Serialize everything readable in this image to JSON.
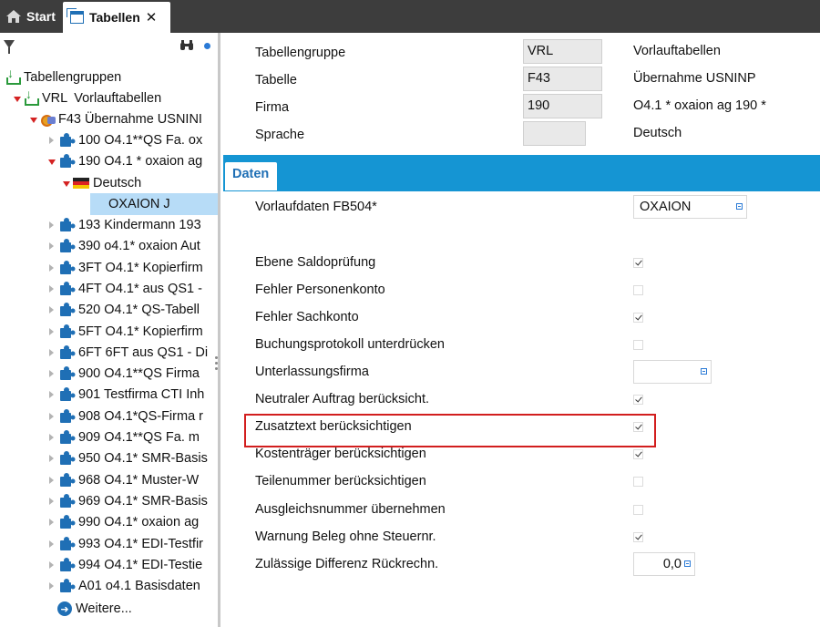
{
  "tabs": [
    {
      "label": "Start",
      "icon": "home-icon"
    },
    {
      "label": "Tabellen",
      "icon": "window-icon",
      "close": "✕"
    }
  ],
  "tree": {
    "root": "Tabellengruppen",
    "group": {
      "code": "VRL",
      "desc": "Vorlauftabellen"
    },
    "table": "F43  Übernahme USNINI",
    "items_before": [
      "100 O4.1**QS Fa. ox",
      "190 O4.1 * oxaion ag"
    ],
    "language": "Deutsch",
    "selected": "OXAION  J",
    "items_after": [
      "193 Kindermann 193",
      "390 o4.1* oxaion Aut",
      "3FT O4.1* Kopierfirm",
      "4FT O4.1* aus QS1 -",
      "520 O4.1* QS-Tabell",
      "5FT O4.1* Kopierfirm",
      "6FT 6FT aus QS1 - Di",
      "900 O4.1**QS Firma",
      "901 Testfirma CTI Inh",
      "908 O4.1*QS-Firma r",
      "909 O4.1**QS Fa. m",
      "950 O4.1* SMR-Basis",
      "968 O4.1* Muster-W",
      "969 O4.1* SMR-Basis",
      "990 O4.1* oxaion ag",
      "993 O4.1* EDI-Testfir",
      "994 O4.1* EDI-Testie",
      "A01 o4.1 Basisdaten"
    ],
    "more": "Weitere..."
  },
  "header": {
    "rows": [
      {
        "label": "Tabellengruppe",
        "value": "VRL",
        "desc": "Vorlauftabellen"
      },
      {
        "label": "Tabelle",
        "value": "F43",
        "desc": "Übernahme USNINP"
      },
      {
        "label": "Firma",
        "value": "190",
        "desc": "O4.1 * oxaion ag 190   *"
      },
      {
        "label": "Sprache",
        "value": "",
        "desc": "Deutsch"
      }
    ]
  },
  "section": {
    "tab": "Daten"
  },
  "form": {
    "vorlauf_label": "Vorlaufdaten FB504*",
    "vorlauf_value": "OXAION",
    "rows": [
      {
        "label": "Ebene Saldoprüfung",
        "checked": true
      },
      {
        "label": "Fehler Personenkonto",
        "checked": false
      },
      {
        "label": "Fehler Sachkonto",
        "checked": true
      },
      {
        "label": "Buchungsprotokoll unterdrücken",
        "checked": false
      },
      {
        "label": "Unterlassungsfirma",
        "input": ""
      },
      {
        "label": "Neutraler Auftrag berücksicht.",
        "checked": true
      },
      {
        "label": "Zusatztext berücksichtigen",
        "checked": true
      },
      {
        "label": "Kostenträger berücksichtigen",
        "checked": true
      },
      {
        "label": "Teilenummer berücksichtigen",
        "checked": false
      },
      {
        "label": "Ausgleichsnummer übernehmen",
        "checked": false
      },
      {
        "label": "Warnung Beleg ohne Steuernr.",
        "checked": true
      },
      {
        "label": "Zulässige Differenz Rückrechn.",
        "input": "0,0"
      }
    ]
  },
  "colors": {
    "accent": "#1595d3",
    "highlight": "#d21e1e",
    "selection": "#b7dcf7",
    "tabbar": "#3d3d3d"
  }
}
